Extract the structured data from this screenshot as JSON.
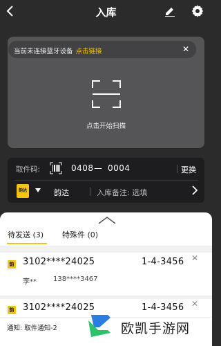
{
  "header": {
    "title": "入库",
    "back_icon": "chevron-left-icon",
    "edit_icon": "pencil-icon",
    "settings_icon": "gear-icon"
  },
  "bluetooth": {
    "message": "当前未连接蓝牙设备",
    "link_label": "点击链接",
    "close_label": "✕"
  },
  "scan": {
    "icon": "scan-frame-icon",
    "label": "点击开始扫描"
  },
  "pickup": {
    "label": "取件码:",
    "code_start": "0408",
    "separator": "—",
    "code_end": "0004",
    "change_label": "更换"
  },
  "courier": {
    "logo_text": "韵达",
    "name": "韵达",
    "remark_label": "入库备注: 选填"
  },
  "tabs": [
    {
      "label": "待发送 (3)",
      "active": true
    },
    {
      "label": "特殊件 (0)",
      "active": false
    }
  ],
  "packages": [
    {
      "badge": "韵",
      "tracking": "3102****24025",
      "shelf": "1-4-3456",
      "recipient": "李**",
      "phone": "138****3467"
    },
    {
      "badge": "韵",
      "tracking": "3102****24025",
      "shelf": "1-4-3456"
    }
  ],
  "notice": {
    "text": "通知: 取件通知-2"
  },
  "watermark": {
    "text": "欧凯手游网"
  },
  "colors": {
    "accent": "#f3c316",
    "dark_bg": "#2b2b2b",
    "panel": "#555558"
  }
}
